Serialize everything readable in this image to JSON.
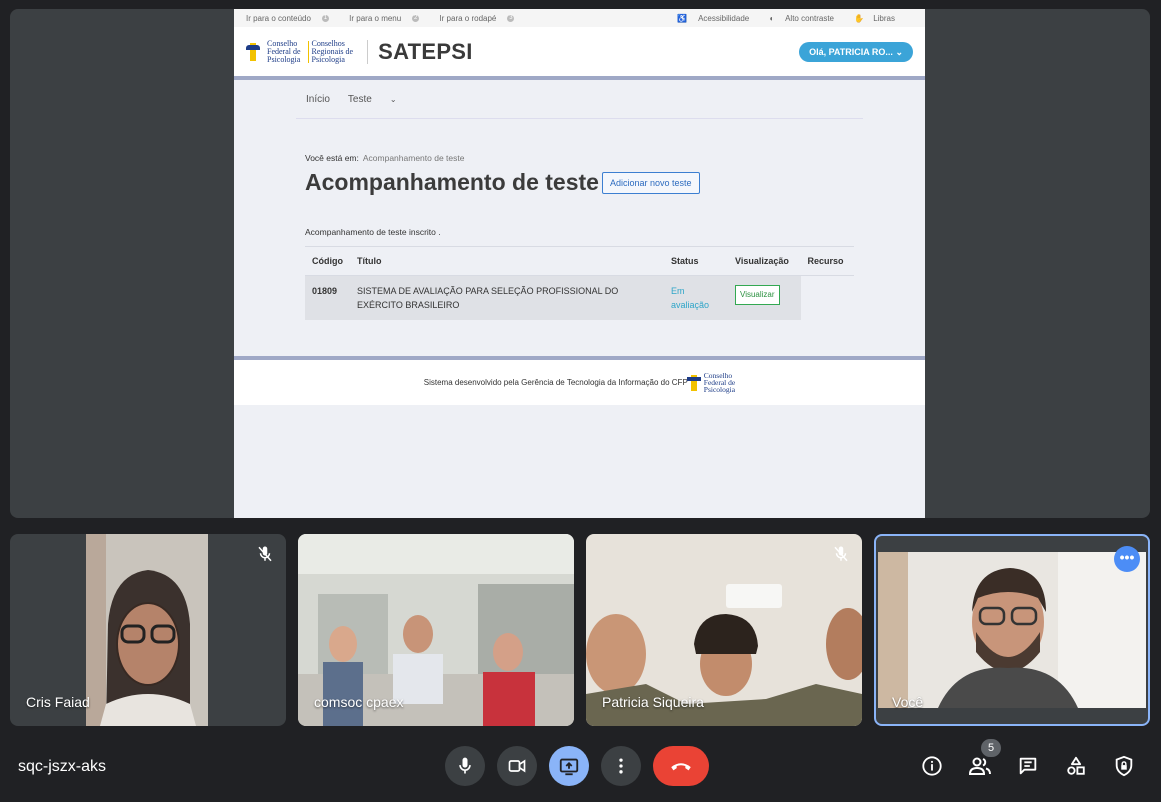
{
  "shared_screen": {
    "skip_links": [
      {
        "label": "Ir para o conteúdo",
        "num": "1"
      },
      {
        "label": "Ir para o menu",
        "num": "2"
      },
      {
        "label": "Ir para o rodapé",
        "num": "3"
      }
    ],
    "accessibility": {
      "acessibilidade": "Acessibilidade",
      "alto_contraste": "Alto contraste",
      "libras": "Libras"
    },
    "logo": {
      "line1a": "Conselho",
      "line1b": "Federal de",
      "line1c": "Psicologia",
      "line2a": "Conselhos",
      "line2b": "Regionais de",
      "line2c": "Psicologia"
    },
    "brand": "SATEPSI",
    "user_greeting": "Olá, PATRICIA RO...",
    "nav": {
      "inicio": "Início",
      "teste": "Teste"
    },
    "breadcrumb": {
      "label": "Você está em:",
      "current": "Acompanhamento de teste"
    },
    "page_title": "Acompanhamento de teste",
    "add_button": "Adicionar novo teste",
    "subtitle": "Acompanhamento de teste inscrito .",
    "table": {
      "headers": [
        "Código",
        "Título",
        "Status",
        "Visualização",
        "Recurso"
      ],
      "row": {
        "codigo": "01809",
        "titulo": "SISTEMA DE AVALIAÇÃO PARA SELEÇÃO PROFISSIONAL DO EXÉRCITO BRASILEIRO",
        "status": "Em avaliação",
        "visualizar": "Visualizar"
      }
    },
    "footer": {
      "text": "Sistema desenvolvido pela Gerência de Tecnologia da Informação do CFP",
      "logo_a": "Conselho",
      "logo_b": "Federal de",
      "logo_c": "Psicologia"
    }
  },
  "participants": [
    {
      "name": "Cris Faiad",
      "muted": true
    },
    {
      "name": "comsoc cpaex",
      "muted": false
    },
    {
      "name": "Patricia Siqueira",
      "muted": true
    },
    {
      "name": "Você",
      "muted": false
    }
  ],
  "meeting_code": "sqc-jszx-aks",
  "people_count": "5",
  "colors": {
    "accent": "#8ab4f8",
    "end_call": "#ea4335",
    "background": "#202124"
  }
}
